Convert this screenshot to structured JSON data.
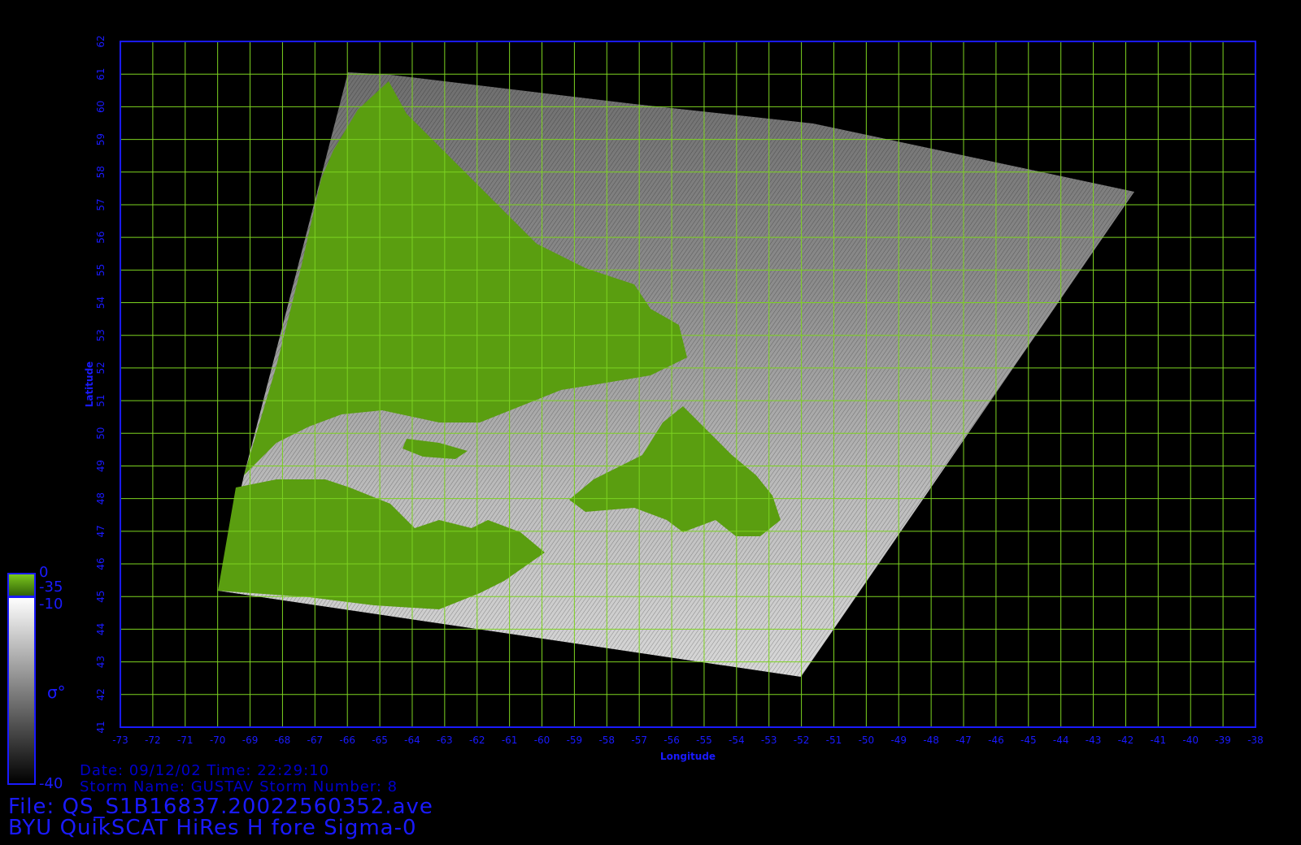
{
  "colors": {
    "background": "#000000",
    "axis": "#1a1aff",
    "grid": "#7dd321",
    "land": "#5a9e10"
  },
  "axes": {
    "xlabel": "Longitude",
    "ylabel": "Latitude",
    "lon_range": [
      -73,
      -38
    ],
    "lat_range": [
      41,
      62
    ],
    "lon_ticks": [
      "-73",
      "-72",
      "-71",
      "-70",
      "-69",
      "-68",
      "-67",
      "-66",
      "-65",
      "-64",
      "-63",
      "-62",
      "-61",
      "-60",
      "-59",
      "-58",
      "-57",
      "-56",
      "-55",
      "-54",
      "-53",
      "-52",
      "-51",
      "-50",
      "-49",
      "-48",
      "-47",
      "-46",
      "-45",
      "-44",
      "-43",
      "-42",
      "-41",
      "-40",
      "-39",
      "-38"
    ],
    "lat_ticks": [
      "41",
      "42",
      "43",
      "44",
      "45",
      "46",
      "47",
      "48",
      "49",
      "50",
      "51",
      "52",
      "53",
      "54",
      "55",
      "56",
      "57",
      "58",
      "59",
      "60",
      "61",
      "62"
    ]
  },
  "colorbar": {
    "land_top": "0",
    "land_bottom": "-35",
    "sea_top": "-10",
    "sea_bottom": "-40",
    "symbol": "σ°"
  },
  "info": {
    "date_line": "Date: 09/12/02  Time: 22:29:10",
    "storm_line": "Storm Name: GUSTAV  Storm Number: 8",
    "file_line": "File: QS_S1B16837.20022560352.ave",
    "product_line": "BYU QuikSCAT HiRes H fore Sigma-0"
  }
}
